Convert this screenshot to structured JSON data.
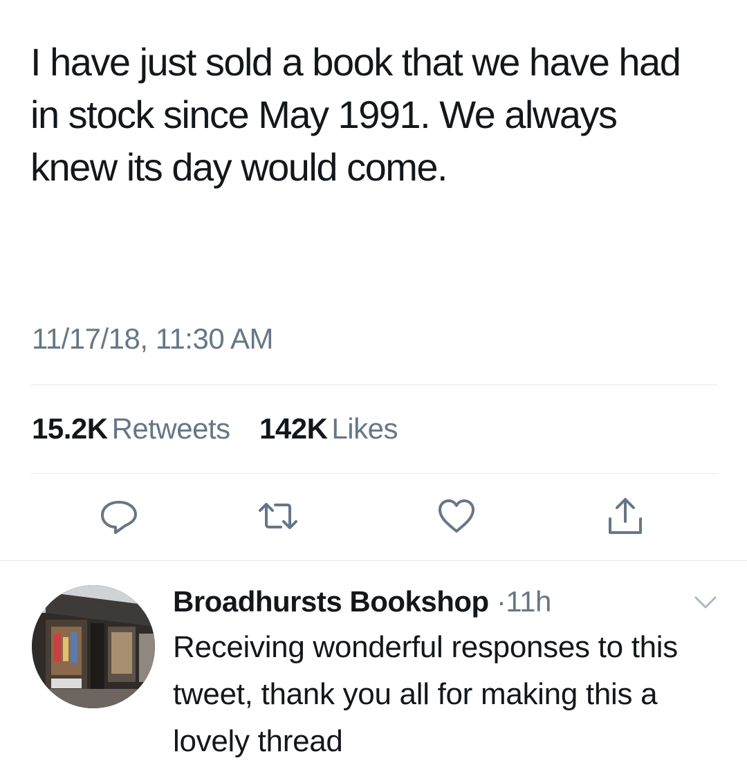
{
  "tweet": {
    "text": "I have just sold a book that we have had in stock since May 1991. We always knew its day would come.",
    "timestamp": "11/17/18, 11:30 AM",
    "retweets_count": "15.2K",
    "retweets_label": "Retweets",
    "likes_count": "142K",
    "likes_label": "Likes"
  },
  "actions": {
    "icons": [
      "reply-icon",
      "retweet-icon",
      "like-icon",
      "share-icon"
    ],
    "icon_color": "#657786"
  },
  "reply": {
    "author": "Broadhursts Bookshop",
    "separator": "·",
    "age": "11h",
    "text": "Receiving wonderful responses to this tweet, thank you all for making this a lovely thread"
  },
  "colors": {
    "text": "#14171a",
    "secondary": "#657786",
    "divider": "#e1e8ed"
  }
}
